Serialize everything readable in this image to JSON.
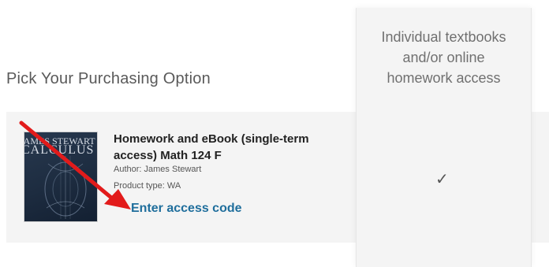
{
  "page": {
    "heading": "Pick Your Purchasing Option"
  },
  "option_column": {
    "header_lines": [
      "Individual textbooks",
      "and/or online",
      "homework access"
    ],
    "selected_mark": "✓"
  },
  "product": {
    "cover_title_line1": "JAMES STEWART",
    "cover_title_line2": "CALCULUS",
    "title": "Homework and eBook (single-term access) Math 124 F",
    "author": "Author: James Stewart",
    "product_type": "Product type: WA",
    "access_link_label": "Enter access code"
  },
  "annotation": {
    "arrow_color": "#e21b1b"
  },
  "colors": {
    "link": "#1f6e9c",
    "row_background": "#f4f4f4"
  }
}
